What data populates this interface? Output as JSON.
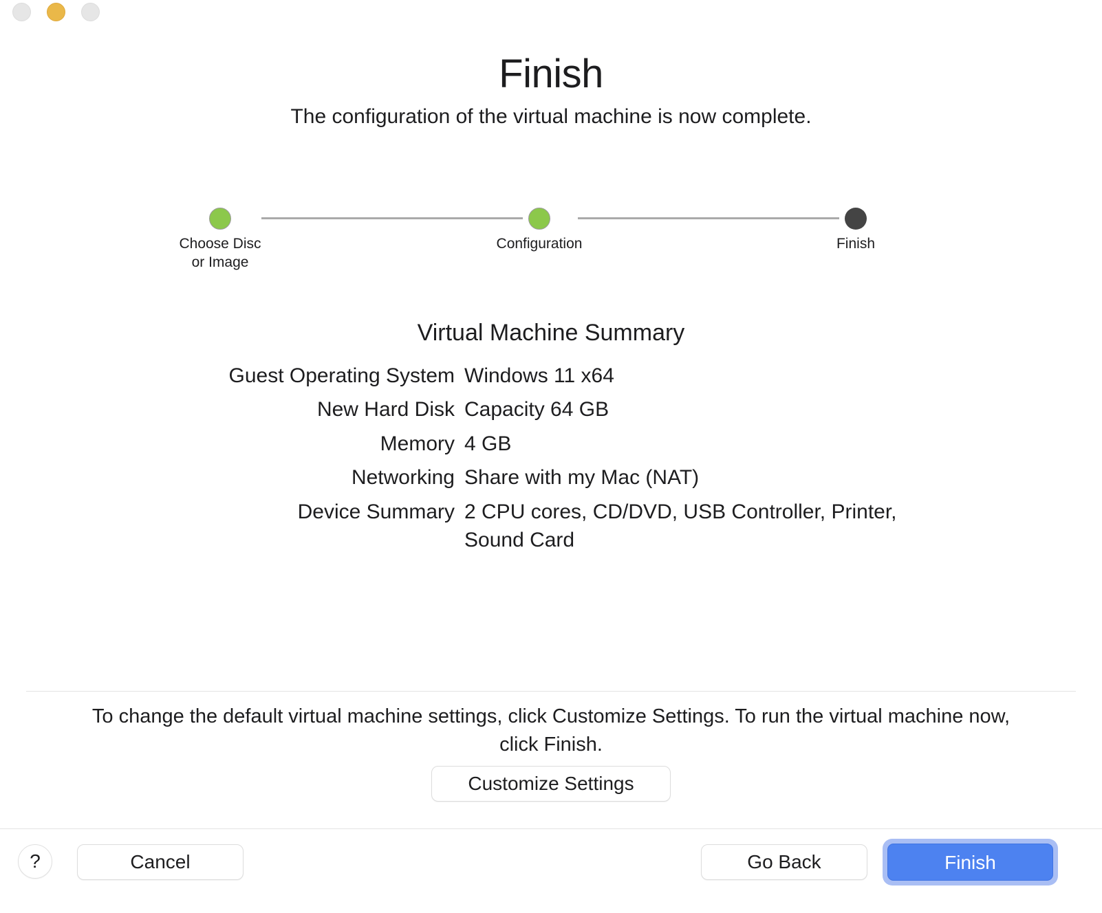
{
  "window": {
    "traffic_lights": [
      {
        "name": "close",
        "color": "#e6e6e6",
        "state": "disabled"
      },
      {
        "name": "minimize",
        "color": "#eab849",
        "state": "enabled"
      },
      {
        "name": "zoom",
        "color": "#e6e6e6",
        "state": "disabled"
      }
    ]
  },
  "header": {
    "title": "Finish",
    "subtitle": "The configuration of the virtual machine is now complete."
  },
  "stepper": {
    "steps": [
      {
        "label": "Choose Disc\nor Image",
        "state": "done",
        "color": "#8cc84b"
      },
      {
        "label": "Configuration",
        "state": "done",
        "color": "#8cc84b"
      },
      {
        "label": "Finish",
        "state": "current",
        "color": "#444444"
      }
    ],
    "line_color": "#aaaaaa"
  },
  "summary": {
    "title": "Virtual Machine Summary",
    "rows": [
      {
        "label": "Guest Operating System",
        "value": "Windows 11 x64"
      },
      {
        "label": "New Hard Disk",
        "value": "Capacity 64 GB"
      },
      {
        "label": "Memory",
        "value": "4 GB"
      },
      {
        "label": "Networking",
        "value": "Share with my Mac (NAT)"
      },
      {
        "label": "Device Summary",
        "value": "2 CPU cores, CD/DVD, USB Controller, Printer, Sound Card"
      }
    ]
  },
  "footer": {
    "note": "To change the default virtual machine settings, click Customize Settings. To run the virtual machine now, click Finish.",
    "customize_label": "Customize Settings"
  },
  "buttons": {
    "help_label": "?",
    "cancel_label": "Cancel",
    "go_back_label": "Go Back",
    "finish_label": "Finish",
    "finish_accent": "#4d82f0",
    "finish_focus_ring": "#a9bef4"
  }
}
